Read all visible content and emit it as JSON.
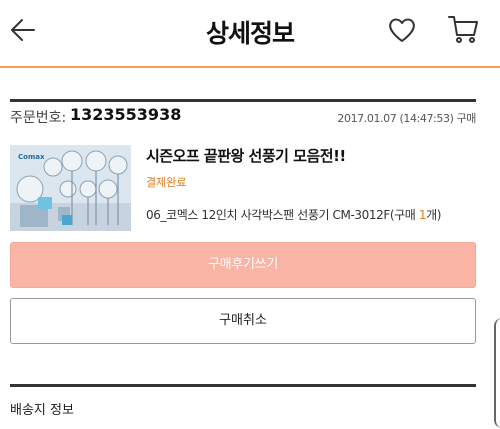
{
  "header": {
    "title": "상세정보",
    "back_icon": "arrow-left-icon",
    "wishlist_icon": "heart-icon",
    "cart_icon": "cart-icon"
  },
  "order": {
    "number_label": "주문번호:",
    "number": "1323553938",
    "date": "2017.01.07 (14:47:53) 구매"
  },
  "product": {
    "name": "시즌오프 끝판왕 선풍기 모음전!!",
    "status": "결제완료",
    "option_prefix": "06_코멕스 12인치 사각박스팬 선풍기 CM-3012F(구매 ",
    "quantity": "1",
    "option_suffix": "개)",
    "thumbnail_brand": "Comax"
  },
  "buttons": {
    "review_label": "구매후기쓰기",
    "cancel_label": "구매취소"
  },
  "shipping": {
    "heading": "배송지 정보"
  },
  "colors": {
    "accent_orange": "#e07a1c",
    "header_border": "#f0a05a",
    "review_button_bg": "#f9b4a6"
  }
}
